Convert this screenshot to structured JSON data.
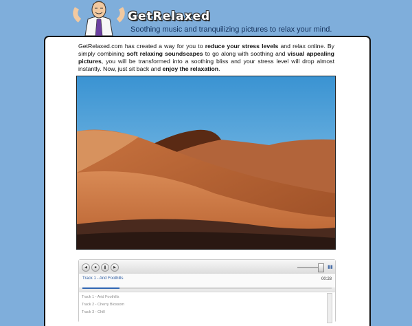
{
  "header": {
    "logo": "GetRelaxed",
    "tagline": "Soothing music and tranquilizing pictures to relax your mind."
  },
  "intro": {
    "p1": "GetRelaxed.com has created a way for you to ",
    "b1": "reduce your stress levels",
    "p2": " and relax online. By simply combining ",
    "b2": "soft relaxing soundscapes",
    "p3": " to go along with soothing and ",
    "b3": "visual appealing pictures",
    "p4": ", you will be transformed into a soothing bliss and your stress level will drop almost instantly. Now, just sit back and ",
    "b4": "enjoy the relaxation",
    "p5": "."
  },
  "player": {
    "now_playing": "Track 1 - Arid Foothills",
    "time": "00:28",
    "progress": 0.15,
    "volume": 0.8,
    "tracks": [
      {
        "label": "Track 1 - Arid Foothills"
      },
      {
        "label": "Track 2 - Cherry Blossom"
      },
      {
        "label": "Track 3 - Chill"
      }
    ]
  },
  "colors": {
    "background": "#7faedb",
    "link_blue": "#2a5aa0"
  }
}
